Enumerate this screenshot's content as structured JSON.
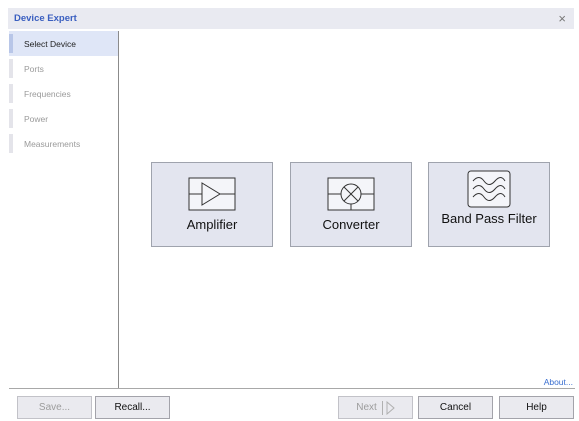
{
  "window": {
    "title": "Device Expert",
    "close_glyph": "×"
  },
  "sidebar": {
    "items": [
      {
        "label": "Select Device",
        "active": true
      },
      {
        "label": "Ports",
        "active": false
      },
      {
        "label": "Frequencies",
        "active": false
      },
      {
        "label": "Power",
        "active": false
      },
      {
        "label": "Measurements",
        "active": false
      }
    ]
  },
  "devices": [
    {
      "label": "Amplifier",
      "icon": "amplifier-icon"
    },
    {
      "label": "Converter",
      "icon": "mixer-icon"
    },
    {
      "label": "Band Pass Filter",
      "icon": "bandpass-filter-icon"
    }
  ],
  "about_link": "About...",
  "buttons": {
    "save": "Save...",
    "recall": "Recall...",
    "next": "Next",
    "cancel": "Cancel",
    "help": "Help"
  },
  "colors": {
    "title_text": "#3a5fc0",
    "active_step_bg": "#dfe6f7",
    "tile_bg": "#e3e5ef",
    "link": "#3a6fd0"
  }
}
